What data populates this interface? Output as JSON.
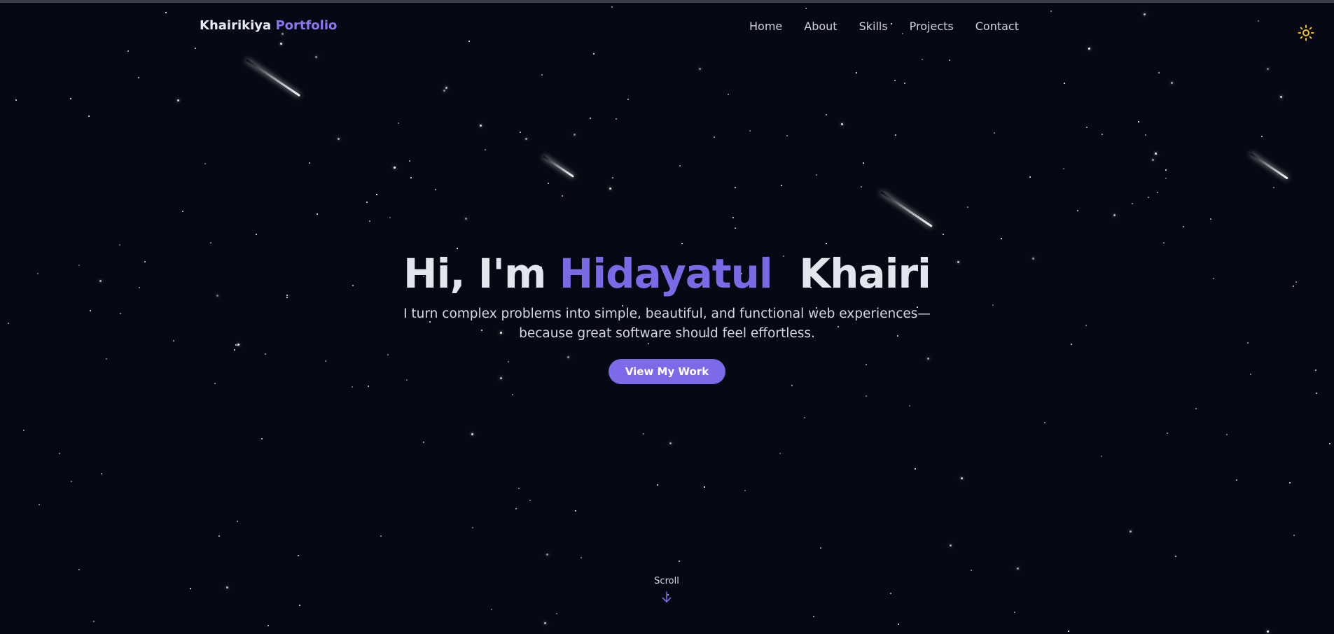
{
  "nav": {
    "brand_primary": "Khairikiya",
    "brand_accent": "Portfolio",
    "links": [
      "Home",
      "About",
      "Skills",
      "Projects",
      "Contact"
    ],
    "theme_toggle_icon": "sun-icon"
  },
  "hero": {
    "greeting": "Hi, I'm",
    "first_name": "Hidayatul",
    "last_name": "Khairi",
    "subtitle": "I turn complex problems into simple, beautiful, and functional web experiences—because great software should feel effortless.",
    "cta_label": "View My Work"
  },
  "scroll": {
    "label": "Scroll",
    "icon": "arrow-down-icon"
  },
  "colors": {
    "background": "#060913",
    "accent": "#7d6ae8",
    "text": "#e4e6ef",
    "sun_icon": "#f5c518"
  }
}
